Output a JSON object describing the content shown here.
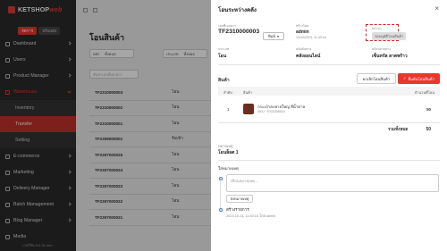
{
  "sidebar": {
    "logo_main": "KETSHOP",
    "logo_accent": "web",
    "toggles": [
      "จัดการ",
      "ปรับแต่ง"
    ],
    "menu": [
      {
        "label": "Dashboard"
      },
      {
        "label": "Users"
      },
      {
        "label": "Product Manager"
      },
      {
        "label": "Warehouse"
      }
    ],
    "warehouse_sub": [
      "Inventory",
      "Transfer",
      "Setting"
    ],
    "menu_after": [
      {
        "label": "E-commerce"
      },
      {
        "label": "Marketing"
      },
      {
        "label": "Delivery Manager"
      },
      {
        "label": "Batch Management"
      },
      {
        "label": "Blog Manager"
      },
      {
        "label": "Media"
      }
    ],
    "version": "เวอร์ชัน 8.0.31-dev"
  },
  "main": {
    "title": "โอนสินค้า",
    "filter1_label": "คลัง",
    "filter1_value": "ทั้งหมด",
    "filter2_label": "ประเภท",
    "filter2_value": "ทั้งหมด",
    "search_placeholder": "ค้นหาเลขที่เอกสาร",
    "rows": [
      {
        "no": "TF2310000003",
        "type": "โอน"
      },
      {
        "no": "TF2310000002",
        "type": "โอน"
      },
      {
        "no": "TF2310000001",
        "type": "โอน"
      },
      {
        "no": "TF2309000001",
        "type": "รับเข้า"
      },
      {
        "no": "TF2307000025",
        "type": "โอน"
      },
      {
        "no": "TF2307000024",
        "type": "โอน"
      },
      {
        "no": "TF2307000023",
        "type": "โอน"
      },
      {
        "no": "TF2307000022",
        "type": "โอน"
      },
      {
        "no": "TF2307000021",
        "type": "โอน"
      }
    ]
  },
  "drawer": {
    "title": "โอนระหว่างคลัง",
    "close": "×",
    "doc_label": "เลขที่เอกสาร",
    "doc_no": "TF2310000003",
    "print_label": "พิมพ์",
    "created_label": "สร้างโดย",
    "created_by": "admin",
    "created_at": "13/10/2023, 11:40:16",
    "status_label": "สถานะ",
    "status": "รออนุมัติโอนสินค้า",
    "type_label": "ประเภท",
    "type": "โอน",
    "from_label": "คลังต้นทาง",
    "from": "คลังออนไลน์",
    "to_label": "คลังปลายทาง",
    "to": "เซ็นทรัล ลาดพร้าว",
    "items_label": "สินค้า",
    "btn_cancel": "ยกเลิกโอนสินค้า",
    "btn_confirm": "ยืนยันโอนสินค้า",
    "col_no": "ลำดับ",
    "col_product": "สินค้า",
    "col_qty": "จำนวนที่โอน",
    "item": {
      "no": "1",
      "name": "กระเป๋าสะพายใหญ่ สีน้ำตาล",
      "sku": "SKU : EX2208510",
      "qty": "50"
    },
    "total_label": "รวมทั้งหมด",
    "total": "50",
    "note_label": "หมายเหตุ",
    "note": "โอนล็อต 1",
    "comment_label": "ใส่หมายเหตุ",
    "comment_placeholder": "เขียนหมายเหตุ...",
    "comment_btn": "ส่งหมายเหตุ",
    "timeline_title": "สร้างรายการ",
    "timeline_meta": "2023-10-13, 11:40:16 โดย admin"
  }
}
